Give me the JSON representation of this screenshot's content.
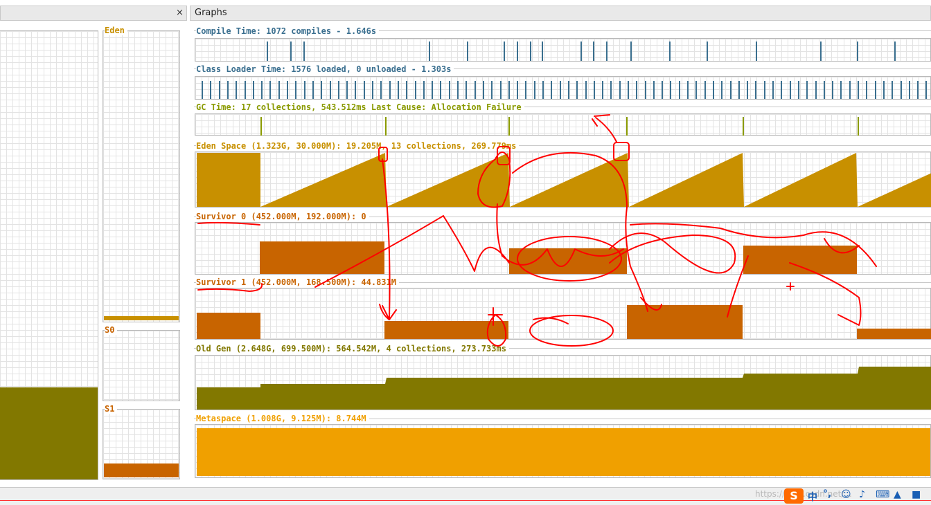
{
  "tabs": {
    "graphs_title": "Graphs",
    "close_glyph": "×"
  },
  "spaces": {
    "eden_label": "Eden",
    "s0_label": "S0",
    "s1_label": "S1"
  },
  "graphs": {
    "compile": {
      "label": "Compile Time: 1072 compiles - 1.646s",
      "color": "#3a6f8f",
      "compiles": 1072,
      "time_s": 1.646
    },
    "classloader": {
      "label": "Class Loader Time: 1576 loaded, 0 unloaded - 1.303s",
      "color": "#3a6f8f",
      "loaded": 1576,
      "unloaded": 0,
      "time_s": 1.303
    },
    "gc": {
      "label": "GC Time: 17 collections, 543.512ms Last Cause: Allocation Failure",
      "color": "#8a9a00",
      "collections": 17,
      "time_ms": 543.512
    },
    "eden": {
      "label": "Eden Space (1.323G, 30.000M): 19.205M, 13 collections, 269.779ms",
      "color": "#c89000"
    },
    "survivor0": {
      "label": "Survivor 0 (452.000M, 192.000M): 0",
      "color": "#c86400"
    },
    "survivor1": {
      "label": "Survivor 1 (452.000M, 168.500M): 44.831M",
      "color": "#c86400"
    },
    "oldgen": {
      "label": "Old Gen (2.648G, 699.500M): 564.542M, 4 collections, 273.733ms",
      "color": "#827800"
    },
    "metaspace": {
      "label": "Metaspace (1.008G, 9.125M): 8.744M",
      "color": "#f0a000"
    }
  },
  "colors": {
    "eden_panel": "#c89000",
    "old_panel": "#827800",
    "survivor_panel": "#c86400",
    "annotation": "#ff0000",
    "grid": "#e3e3e3"
  },
  "taskbar": {
    "watermark": "https://blog.csdn.net/...",
    "ime_icon": "sogou-s-icon",
    "ime_text": "中"
  }
}
